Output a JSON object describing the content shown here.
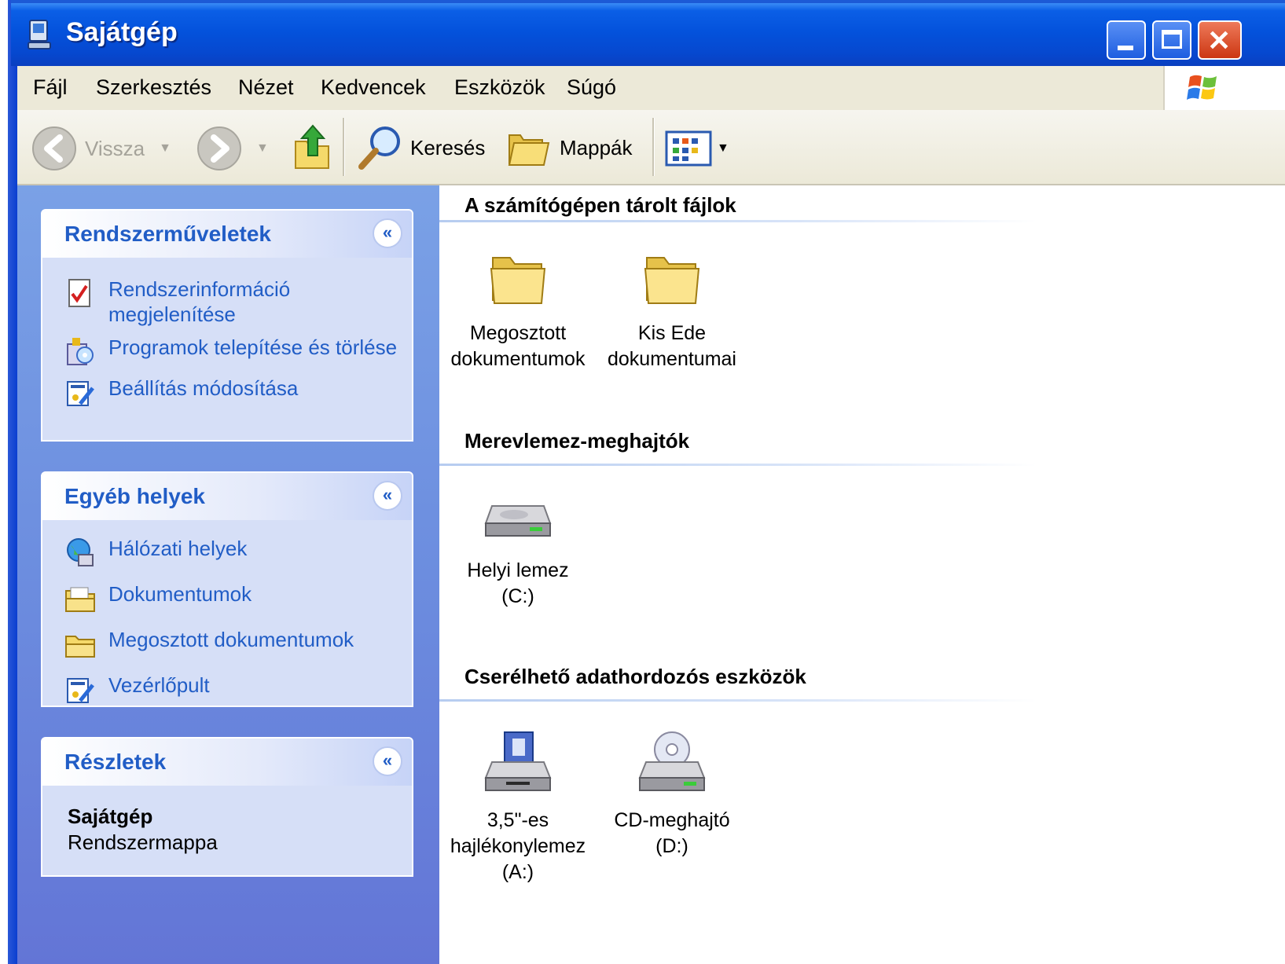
{
  "window": {
    "title": "Sajátgép"
  },
  "menu": [
    "Fájl",
    "Szerkesztés",
    "Nézet",
    "Kedvencek",
    "Eszközök",
    "Súgó"
  ],
  "toolbar": {
    "back_label": "Vissza",
    "search_label": "Keresés",
    "folders_label": "Mappák"
  },
  "sidebar": {
    "system_tasks": {
      "title": "Rendszerműveletek",
      "items": [
        {
          "label": "Rendszerinformáció megjelenítése",
          "icon": "system-info-icon"
        },
        {
          "label": "Programok telepítése és törlése",
          "icon": "add-remove-programs-icon"
        },
        {
          "label": "Beállítás módosítása",
          "icon": "control-panel-icon"
        }
      ]
    },
    "other_places": {
      "title": "Egyéb helyek",
      "items": [
        {
          "label": "Hálózati helyek",
          "icon": "network-places-icon"
        },
        {
          "label": "Dokumentumok",
          "icon": "my-documents-icon"
        },
        {
          "label": "Megosztott dokumentumok",
          "icon": "shared-folder-icon"
        },
        {
          "label": "Vezérlőpult",
          "icon": "control-panel-icon"
        }
      ]
    },
    "details": {
      "title": "Részletek",
      "name": "Sajátgép",
      "type": "Rendszermappa"
    }
  },
  "groups": {
    "stored_files": {
      "title": "A számítógépen tárolt fájlok",
      "items": [
        {
          "line1": "Megosztott",
          "line2": "dokumentumok"
        },
        {
          "line1": "Kis Ede",
          "line2": "dokumentumai"
        }
      ]
    },
    "hard_drives": {
      "title": "Merevlemez-meghajtók",
      "items": [
        {
          "line1": "Helyi lemez",
          "line2": "(C:)"
        }
      ]
    },
    "removable": {
      "title": "Cserélhető adathordozós eszközök",
      "items": [
        {
          "line1": "3,5\"-es",
          "line2": "hajlékonylemez",
          "line3": "(A:)"
        },
        {
          "line1": "CD-meghajtó",
          "line2": "(D:)"
        }
      ]
    }
  },
  "colors": {
    "titlebar": "#0452dc",
    "sidebar_bg": "#6c8ddf",
    "panel_bg": "#d6dff7",
    "link": "#215dc6"
  }
}
